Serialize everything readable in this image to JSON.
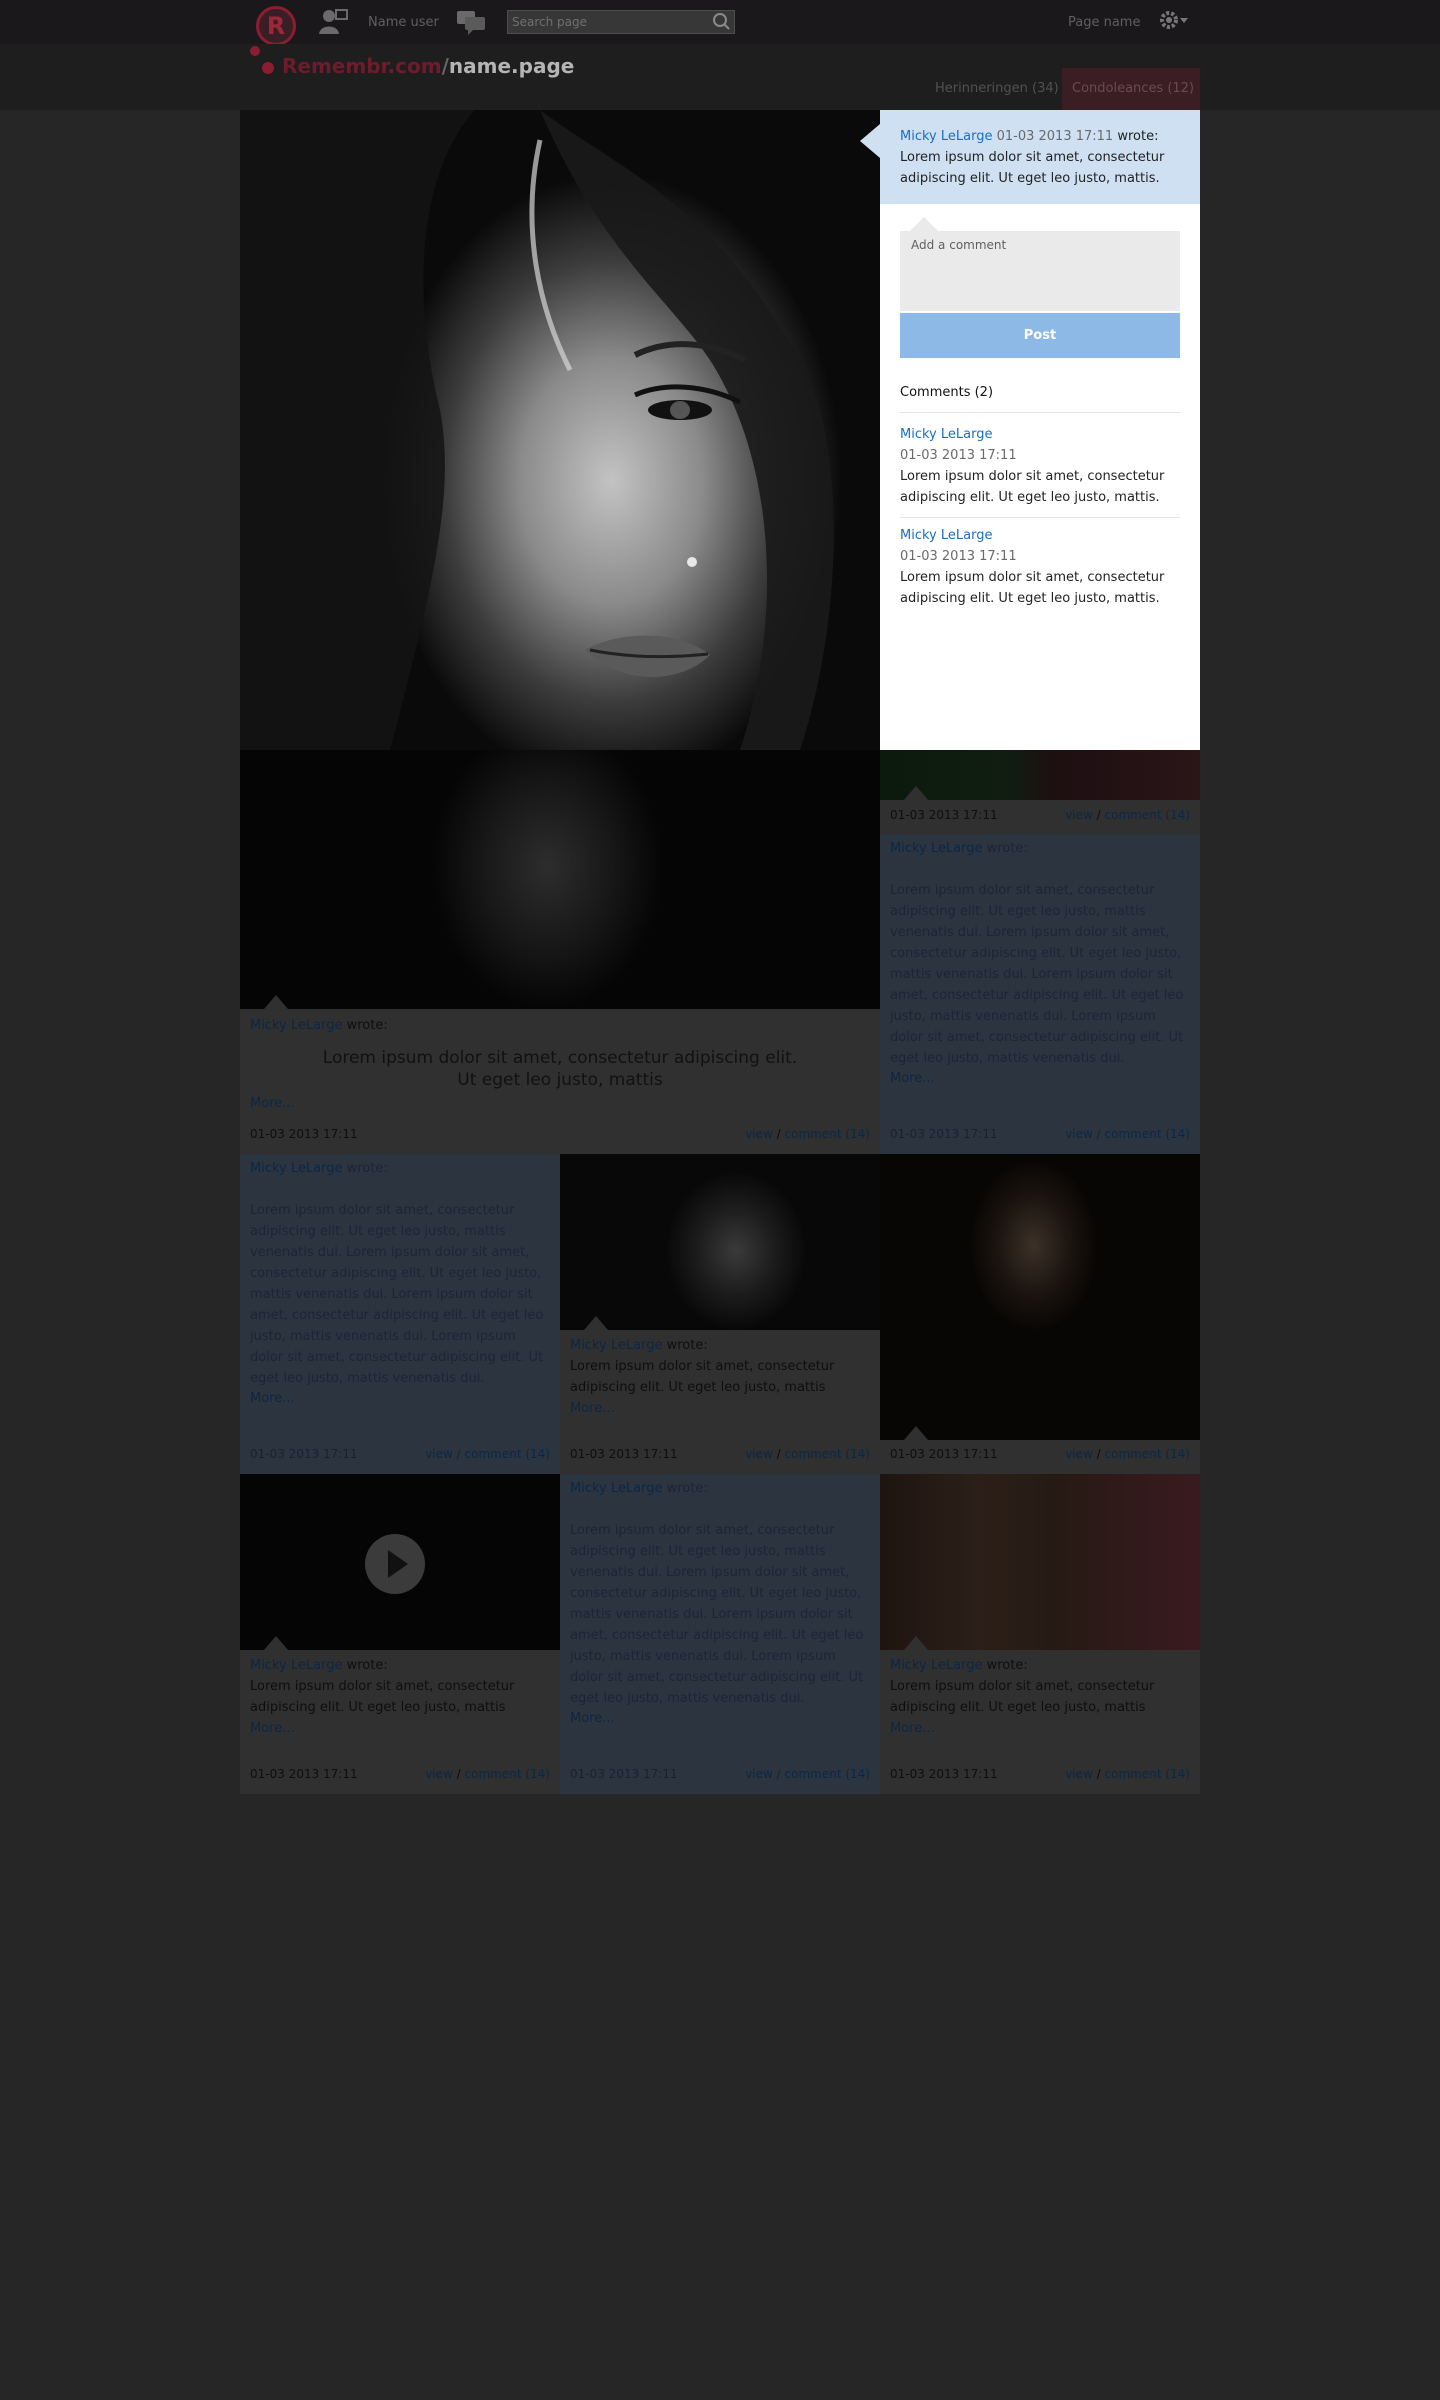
{
  "header": {
    "logo_letter": "R",
    "nav_link": "Name user",
    "search_placeholder": "Search page",
    "page_name": "Page name"
  },
  "brand": {
    "site": "Remembr.com",
    "slash": "/",
    "page": "name.page"
  },
  "tabs": [
    {
      "label": "Herinneringen (34)"
    },
    {
      "label": "Condoleances (12)"
    }
  ],
  "post": {
    "author": "Micky LeLarge",
    "date": "01-03 2013 17:11",
    "verb": "wrote:",
    "text": "Lorem ipsum dolor sit amet, consectetur adipiscing elit. Ut eget leo justo, mattis."
  },
  "comment_form": {
    "placeholder": "Add a comment",
    "post_label": "Post"
  },
  "comments": {
    "title": "Comments (2)",
    "items": [
      {
        "author": "Micky LeLarge",
        "date": "01-03 2013 17:11",
        "text": "Lorem ipsum dolor sit amet, consectetur adipiscing elit. Ut eget leo justo, mattis."
      },
      {
        "author": "Micky LeLarge",
        "date": "01-03 2013 17:11",
        "text": "Lorem ipsum dolor sit amet, consectetur adipiscing elit. Ut eget leo justo, mattis."
      }
    ]
  },
  "common": {
    "author": "Micky LeLarge",
    "wrote": "wrote:",
    "more": "More...",
    "date": "01-03 2013 17:11",
    "view": "view",
    "sep": "/",
    "comment": "comment (14)",
    "short_text": "Lorem ipsum dolor sit amet, consectetur adipiscing elit. Ut eget leo justo, mattis",
    "long_text": "Lorem ipsum dolor sit amet, consectetur adipiscing elit. Ut eget leo justo, mattis venenatis dui.  Lorem ipsum dolor sit amet, consectetur adipiscing elit. Ut eget leo justo, mattis venenatis dui. Lorem ipsum dolor sit amet, consectetur adipiscing elit. Ut eget leo justo, mattis venenatis dui. Lorem ipsum dolor sit amet, consectetur adipiscing elit. Ut eget leo justo, mattis venenatis dui.",
    "quote_line1": "Lorem ipsum dolor sit amet, consectetur adipiscing elit.",
    "quote_line2": "Ut eget leo justo, mattis"
  }
}
